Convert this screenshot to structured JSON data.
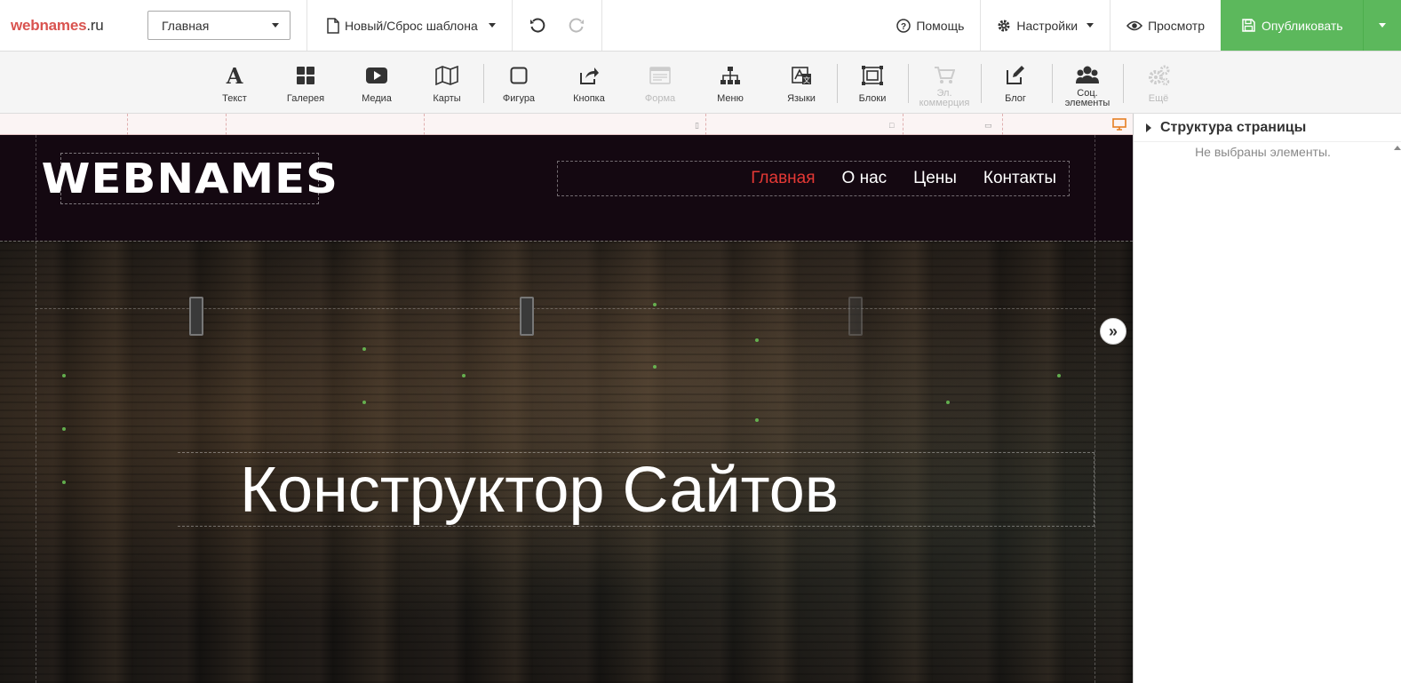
{
  "topbar": {
    "brand_main": "webnames",
    "brand_tld": ".ru",
    "page_select": "Главная",
    "template_button": "Новый/Сброс шаблона",
    "help": "Помощь",
    "settings": "Настройки",
    "preview": "Просмотр",
    "publish": "Опубликовать"
  },
  "widgets": {
    "text": "Текст",
    "gallery": "Галерея",
    "media": "Медиа",
    "maps": "Карты",
    "shape": "Фигура",
    "button": "Кнопка",
    "form": "Форма",
    "menu": "Меню",
    "languages": "Языки",
    "blocks": "Блоки",
    "ecommerce_1": "Эл.",
    "ecommerce_2": "коммерция",
    "blog": "Блог",
    "social_1": "Соц.",
    "social_2": "элементы",
    "more": "Ещё"
  },
  "site": {
    "logo": "WEBNAMES",
    "nav": [
      "Главная",
      "О нас",
      "Цены",
      "Контакты"
    ],
    "hero_title": "Конструктор Сайтов"
  },
  "panel": {
    "title": "Структура страницы",
    "empty": "Не выбраны элементы."
  },
  "colors": {
    "brand": "#d9534f",
    "publish": "#5cb85c",
    "header_bg": "#140811",
    "nav_active": "#e53935"
  }
}
